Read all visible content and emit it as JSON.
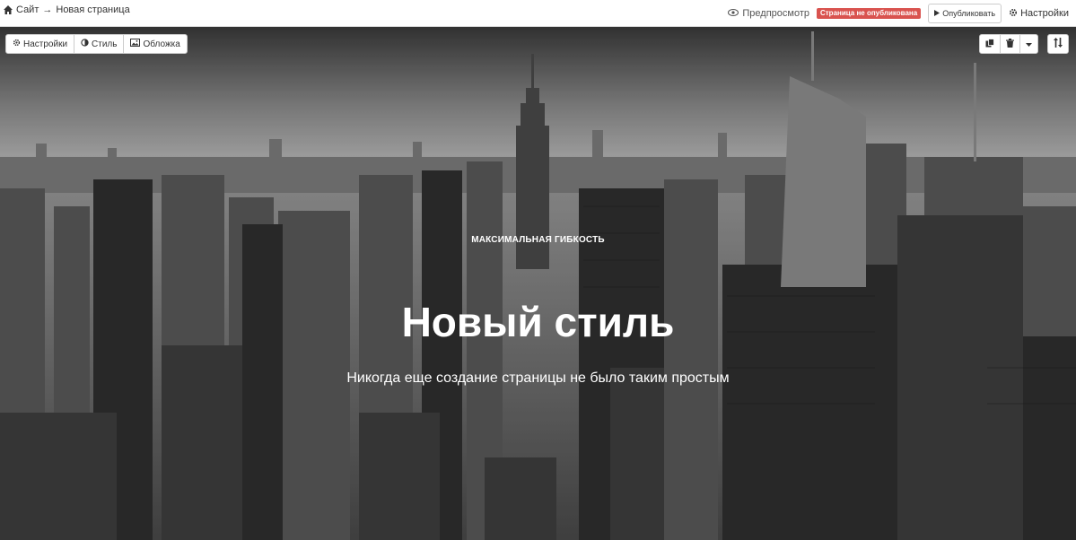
{
  "topbar": {
    "breadcrumb_site": "Сайт",
    "breadcrumb_arrow": "→",
    "breadcrumb_page": "Новая страница",
    "preview_label": "Предпросмотр",
    "status_badge": "Страница не опубликована",
    "publish_label": "Опубликовать",
    "settings_label": "Настройки",
    "status_color": "#d9534f"
  },
  "editor_toolbar": {
    "settings_label": "Настройки",
    "style_label": "Стиль",
    "cover_label": "Обложка",
    "right_icons": [
      "copy-icon",
      "trash-icon",
      "caret-down-icon"
    ],
    "sort_icon": "sort-icon"
  },
  "hero": {
    "kicker": "МАКСИМАЛЬНАЯ ГИБКОСТЬ",
    "title": "Новый стиль",
    "subtitle": "Никогда еще создание страницы не было таким простым",
    "background": "Black-and-white city skyline photo"
  }
}
